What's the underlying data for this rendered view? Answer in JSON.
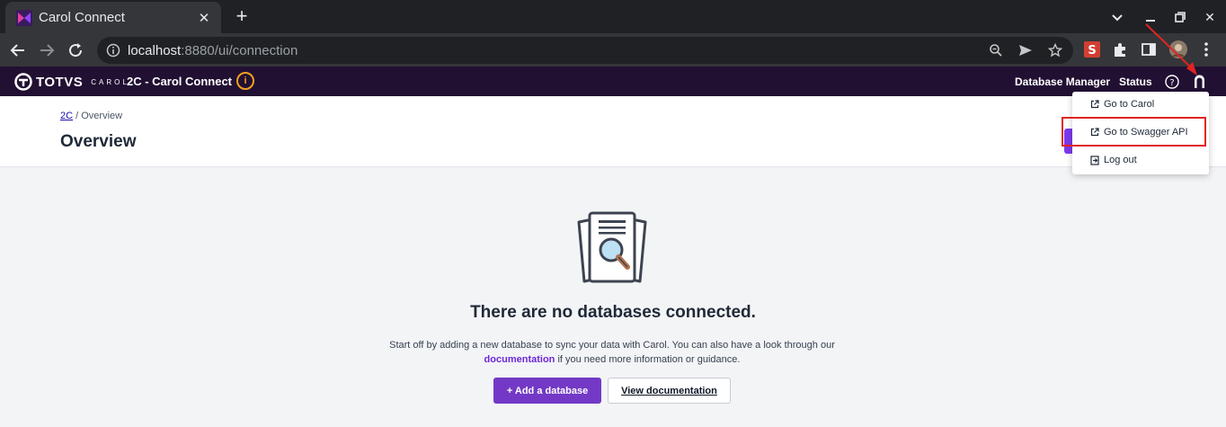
{
  "browser": {
    "tab_title": "Carol Connect",
    "url_host": "localhost",
    "url_path": ":8880/ui/connection",
    "new_tab_symbol": "+",
    "tab_close_symbol": "✕",
    "min_symbol": "—",
    "close_symbol": "✕"
  },
  "app": {
    "brand": "TOTVS",
    "brand_sub": "CAROL",
    "title": "2C - Carol Connect",
    "info_symbol": "i",
    "nav": {
      "database_manager": "Database Manager",
      "status": "Status",
      "help_symbol": "?"
    }
  },
  "page": {
    "breadcrumb_root": "2C",
    "breadcrumb_sep": " / ",
    "breadcrumb_current": "Overview",
    "title": "Overview"
  },
  "empty_state": {
    "title": "There are no databases connected.",
    "text_1": "Start off by adding a new database to sync your data with Carol. You can also have a look through our ",
    "doc_link": "documentation",
    "text_2": " if you need more information or guidance.",
    "add_button": "+ Add a database",
    "view_docs_button": "View documentation"
  },
  "user_menu": {
    "items": [
      {
        "label": "Go to Carol",
        "icon": "external-link-icon"
      },
      {
        "label": "Go to Swagger API",
        "icon": "external-link-icon"
      },
      {
        "label": "Log out",
        "icon": "logout-icon"
      }
    ]
  },
  "colors": {
    "app_header": "#221033",
    "primary": "#7339c6",
    "highlight": "#e02424",
    "info_badge": "#f0a020"
  }
}
